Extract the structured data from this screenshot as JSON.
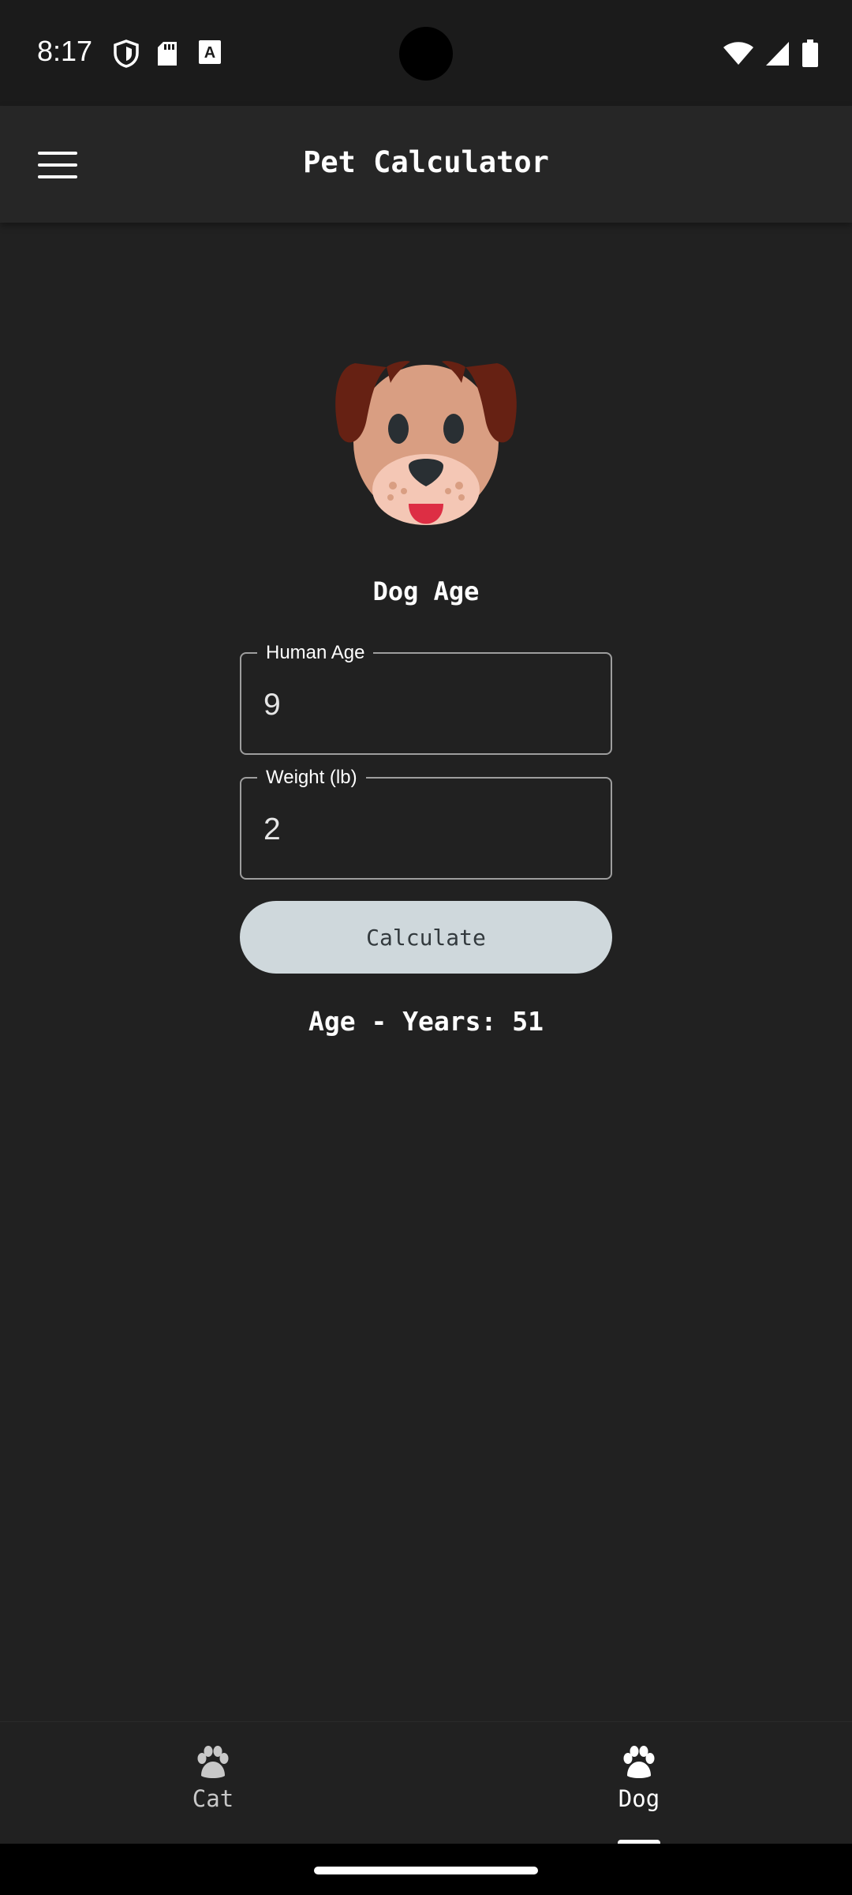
{
  "status_bar": {
    "time": "8:17",
    "left_icons": [
      "shield-icon",
      "sd-card-icon",
      "font-a-icon"
    ],
    "right_icons": [
      "wifi-icon",
      "signal-icon",
      "battery-icon"
    ]
  },
  "app_bar": {
    "title": "Pet Calculator",
    "menu_icon": "hamburger-menu-icon"
  },
  "main": {
    "image": "dog-face-icon",
    "title": "Dog Age",
    "fields": {
      "human_age": {
        "label": "Human Age",
        "value": "9"
      },
      "weight": {
        "label": "Weight (lb)",
        "value": "2"
      }
    },
    "calculate_label": "Calculate",
    "result": "Age - Years: 51"
  },
  "bottom_nav": {
    "items": [
      {
        "label": "Cat",
        "icon": "paw-icon",
        "selected": false
      },
      {
        "label": "Dog",
        "icon": "paw-icon",
        "selected": true
      }
    ]
  },
  "colors": {
    "background": "#212121",
    "app_bar": "#262626",
    "button": "#cfd8dc",
    "outline": "#9e9e9e"
  }
}
